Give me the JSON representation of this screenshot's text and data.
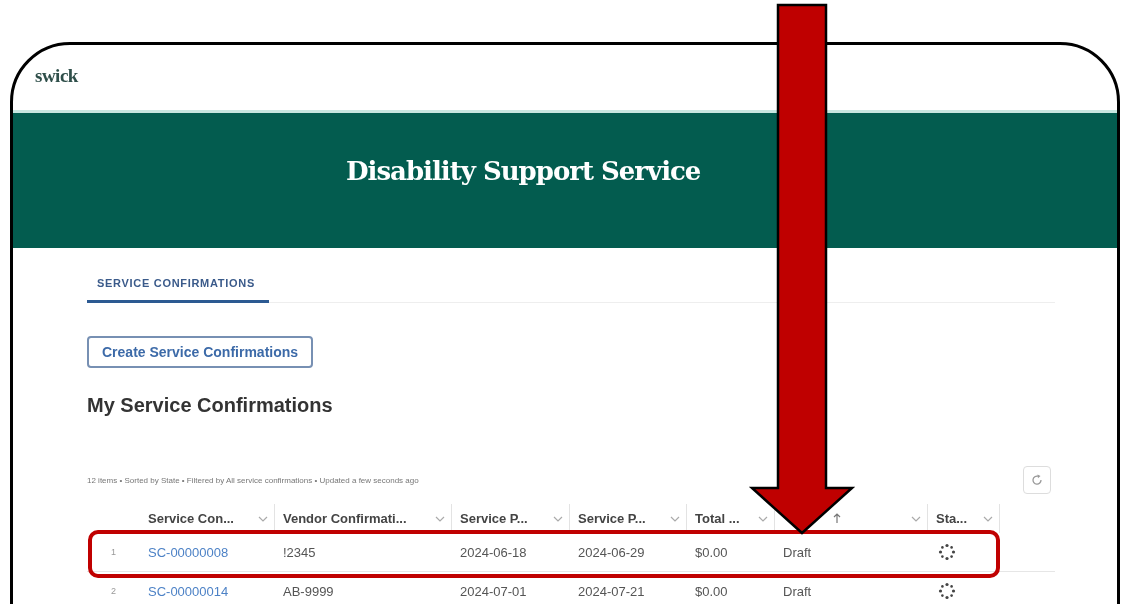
{
  "logo": {
    "text": "swick"
  },
  "banner": {
    "title": "Disability Support Service"
  },
  "tabs": [
    {
      "label": "SERVICE CONFIRMATIONS",
      "selected": true
    }
  ],
  "create_button": "Create Service Confirmations",
  "list_title": "My Service Confirmations",
  "list_info": "12 items • Sorted by State • Filtered by All service confirmations • Updated a few seconds ago",
  "table": {
    "columns": [
      {
        "label": "Service Con..."
      },
      {
        "label": "Vendor Confirmati..."
      },
      {
        "label": "Service P..."
      },
      {
        "label": "Service P..."
      },
      {
        "label": "Total ..."
      },
      {
        "sorted": true
      },
      {
        "label": "Sta..."
      }
    ],
    "rows": [
      {
        "number": "1",
        "cells": [
          "SC-00000008",
          "!2345",
          "2024-06-18",
          "2024-06-29",
          "$0.00",
          "Draft"
        ],
        "status_icon": {
          "kind": "loading"
        }
      },
      {
        "number": "2",
        "cells": [
          "SC-00000014",
          "AB-9999",
          "2024-07-01",
          "2024-07-21",
          "$0.00",
          "Draft"
        ],
        "status_icon": {
          "kind": "loading"
        }
      }
    ]
  },
  "annotations": [
    {
      "kind": "highlight"
    },
    {
      "kind": "arrow"
    }
  ]
}
